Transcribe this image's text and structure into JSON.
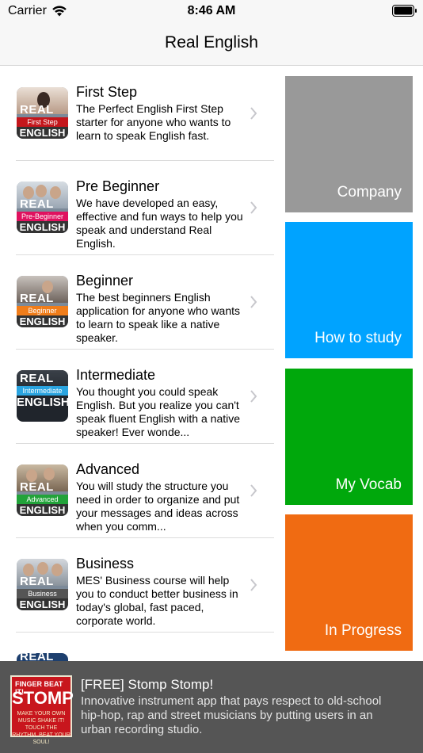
{
  "status_bar": {
    "carrier": "Carrier",
    "time": "8:46 AM"
  },
  "nav": {
    "title": "Real English"
  },
  "courses": [
    {
      "title": "First Step",
      "description": "The Perfect English First Step starter for anyone who wants to learn to speak English fast.",
      "thumb": {
        "real": "REAL",
        "band": "First Step",
        "english": "ENGLISH",
        "band_color": "#c4161c"
      }
    },
    {
      "title": "Pre Beginner",
      "description": "We have developed an easy, effective and fun ways to help you speak and understand Real English.",
      "thumb": {
        "real": "REAL",
        "band": "Pre-Beginner",
        "english": "ENGLISH",
        "band_color": "#e0115f"
      }
    },
    {
      "title": "Beginner",
      "description": "The best beginners English application for anyone who wants to learn to speak like a native speaker.",
      "thumb": {
        "real": "REAL",
        "band": "Beginner",
        "english": "ENGLISH",
        "band_color": "#f07d1a"
      }
    },
    {
      "title": "Intermediate",
      "description": "You thought you could speak English. But you realize you can't speak fluent English with a native speaker! Ever wonde...",
      "thumb": {
        "real": "REAL",
        "band": "Intermediate",
        "english": "ENGLISH",
        "band_color": "#2aa4e0"
      }
    },
    {
      "title": "Advanced",
      "description": "You will study the structure you need in order to organize and put your messages and ideas across when you comm...",
      "thumb": {
        "real": "REAL",
        "band": "Advanced",
        "english": "ENGLISH",
        "band_color": "#22a33a"
      }
    },
    {
      "title": "Business",
      "description": "MES' Business course will help you to conduct better business in today's global, fast paced, corporate world.",
      "thumb": {
        "real": "REAL",
        "band": "Business",
        "english": "ENGLISH",
        "band_color": "#555555"
      }
    },
    {
      "title": "",
      "description": "",
      "thumb": {
        "real": "REAL",
        "band": "",
        "english": "",
        "band_color": "#1d3f6e"
      }
    }
  ],
  "tiles": [
    {
      "label": "Company",
      "color": "#999999"
    },
    {
      "label": "How to study",
      "color": "#00a3ff"
    },
    {
      "label": "My Vocab",
      "color": "#00a80c"
    },
    {
      "label": "In Progress",
      "color": "#f06b12"
    }
  ],
  "ad": {
    "title": "[FREE] Stomp Stomp!",
    "description": "Innovative instrument app that pays respect to old-school hip-hop, rap and street musicians by putting users in an urban recording studio.",
    "logo": {
      "top_text": "FINGER BEAT IT!",
      "main_text": "STOMP",
      "sub_text": "MAKE YOUR OWN MUSIC SHAKE IT! TOUCH THE RHYTHM, BEAT YOUR SOUL!"
    }
  }
}
